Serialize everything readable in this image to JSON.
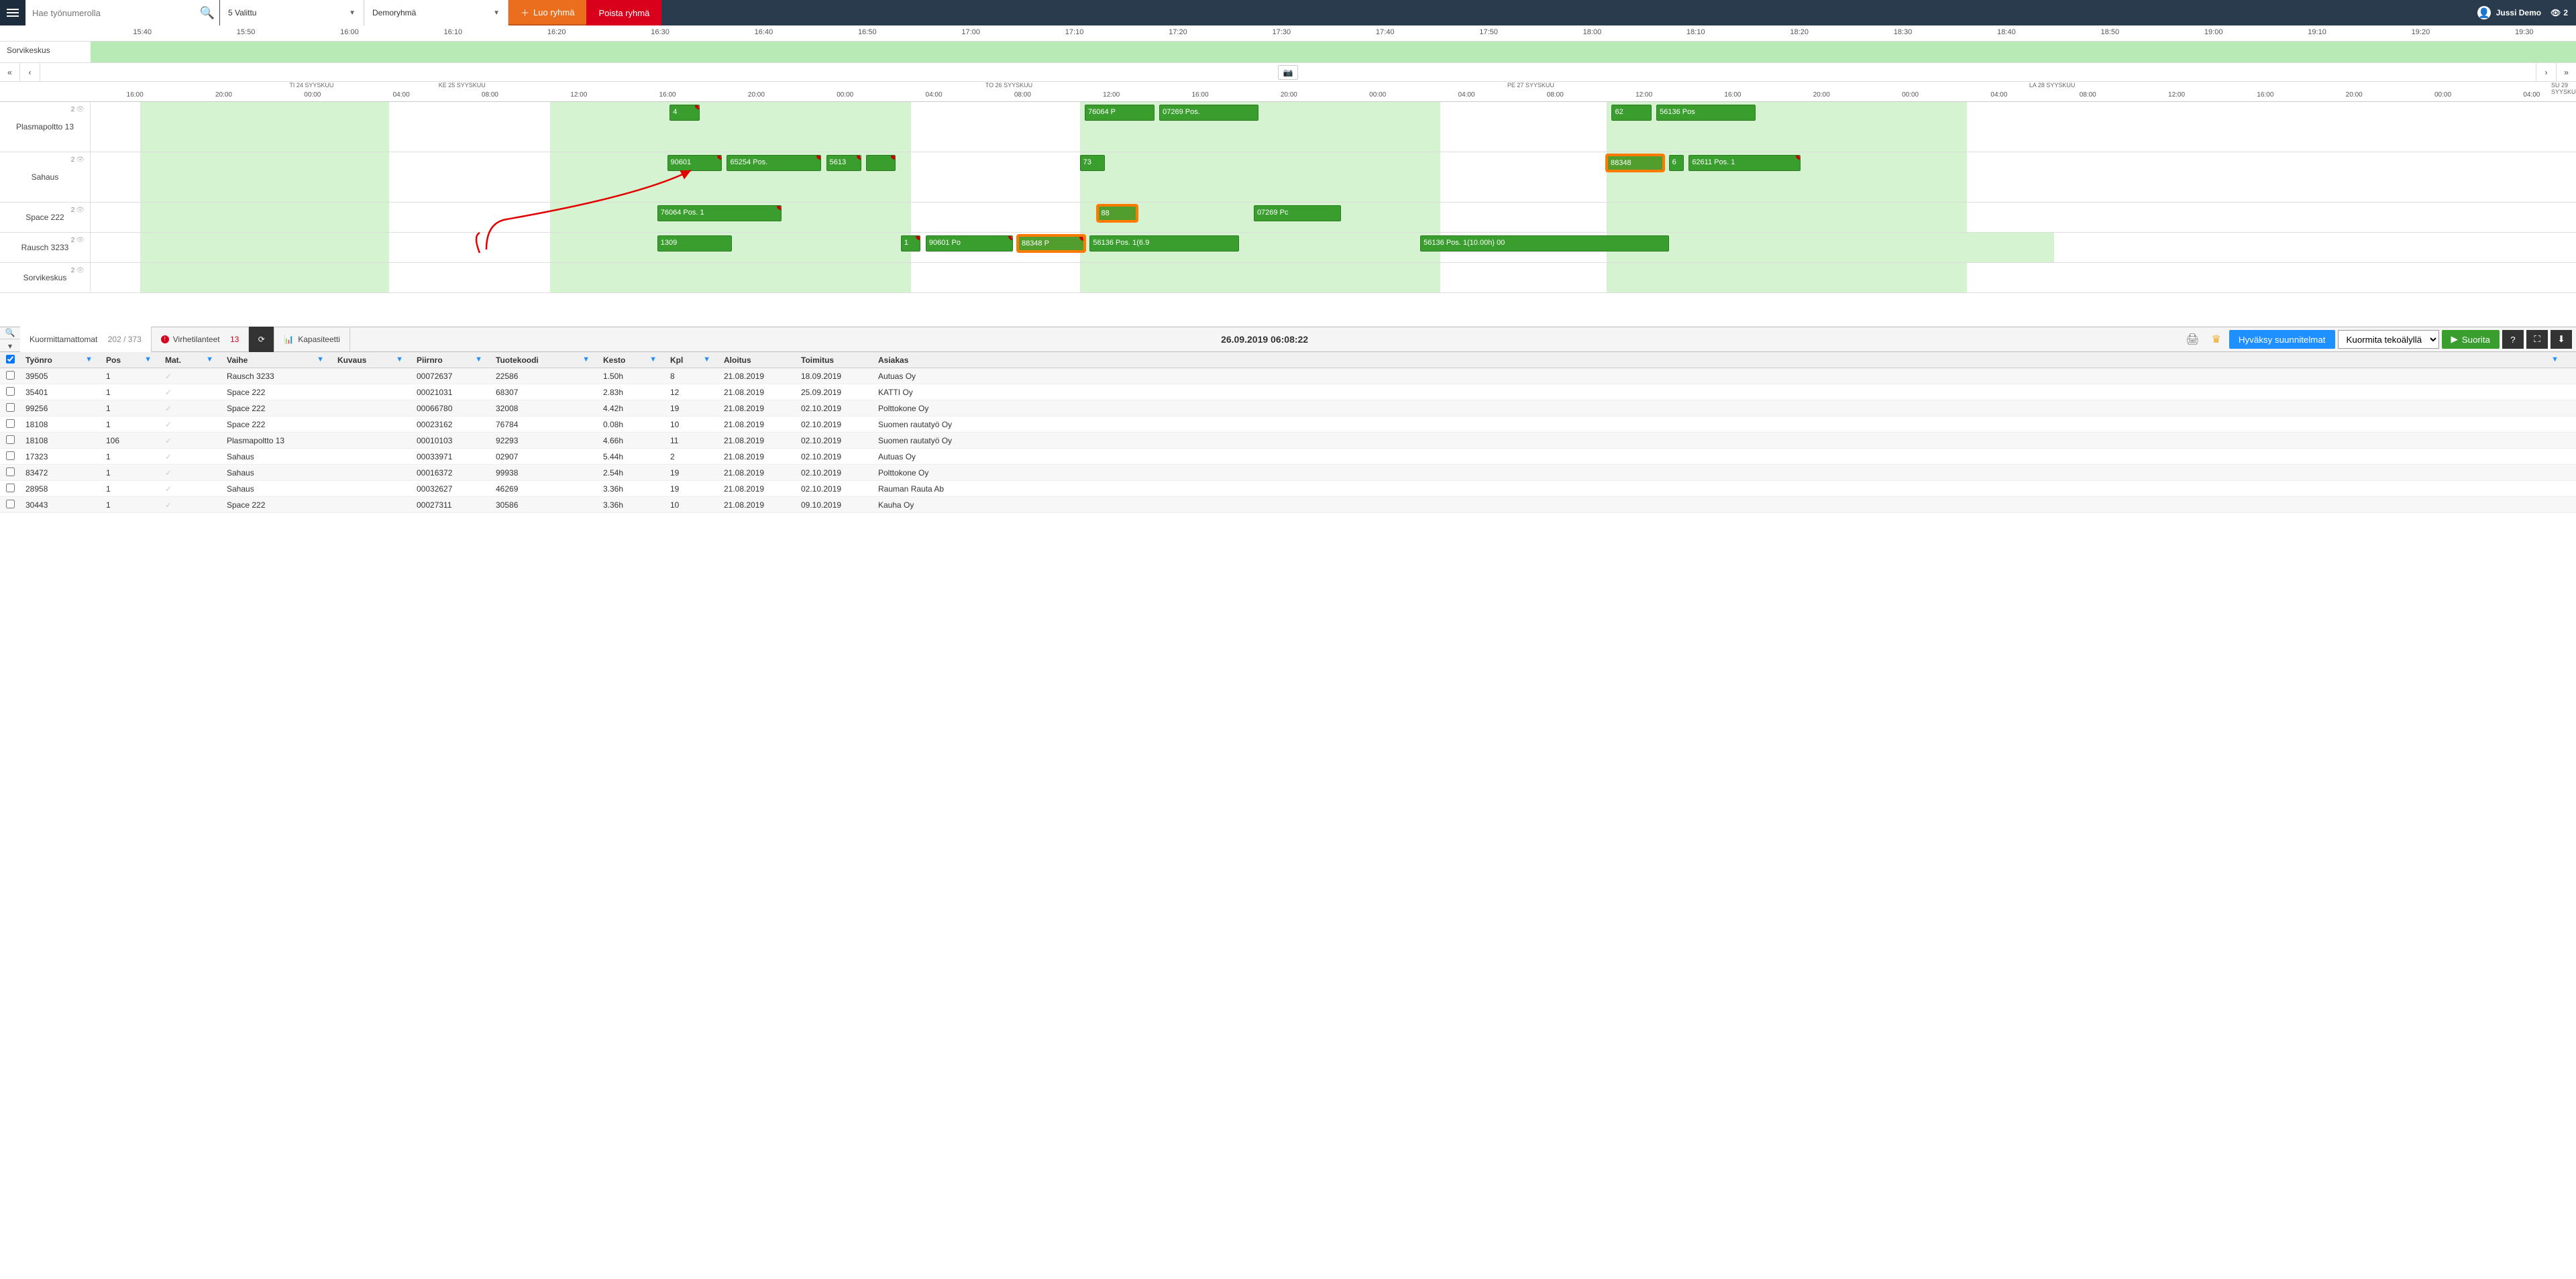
{
  "header": {
    "search_placeholder": "Hae työnumerolla",
    "select1": "5 Valittu",
    "select2": "Demoryhmä",
    "create_group": "Luo ryhmä",
    "delete_group": "Poista ryhmä",
    "user_name": "Jussi Demo",
    "watchers": "2"
  },
  "mini": {
    "label": "Sorvikeskus",
    "ticks": [
      "15:40",
      "15:50",
      "16:00",
      "16:10",
      "16:20",
      "16:30",
      "16:40",
      "16:50",
      "17:00",
      "17:10",
      "17:20",
      "17:30",
      "17:40",
      "17:50",
      "18:00",
      "18:10",
      "18:20",
      "18:30",
      "18:40",
      "18:50",
      "19:00",
      "19:10",
      "19:20",
      "19:30"
    ]
  },
  "gantt": {
    "days": [
      {
        "label": "TI 24 SYYSKUU",
        "left_pct": 8
      },
      {
        "label": "KE 25 SYYSKUU",
        "left_pct": 14
      },
      {
        "label": "TO 26 SYYSKUU",
        "left_pct": 36
      },
      {
        "label": "PE 27 SYYSKUU",
        "left_pct": 57
      },
      {
        "label": "LA 28 SYYSKUU",
        "left_pct": 78
      },
      {
        "label": "SU 29 SYYSKUU",
        "left_pct": 99
      }
    ],
    "hours": [
      "16:00",
      "20:00",
      "00:00",
      "04:00",
      "08:00",
      "12:00",
      "16:00",
      "20:00",
      "00:00",
      "04:00",
      "08:00",
      "12:00",
      "16:00",
      "20:00",
      "00:00",
      "04:00",
      "08:00",
      "12:00",
      "16:00",
      "20:00",
      "00:00",
      "04:00",
      "08:00",
      "12:00",
      "16:00",
      "20:00",
      "00:00",
      "04:00"
    ],
    "now_left_pct": 23.0,
    "rows": [
      {
        "name": "Plasmapoltto 13",
        "count": "2",
        "height": "full",
        "avail": [
          {
            "l": 2,
            "w": 10
          },
          {
            "l": 18.5,
            "w": 14.5
          },
          {
            "l": 39.8,
            "w": 14.5
          },
          {
            "l": 61,
            "w": 14.5
          }
        ],
        "tasks": [
          {
            "l": 23.3,
            "w": 1.2,
            "label": "4",
            "alert": true
          },
          {
            "l": 40,
            "w": 2.8,
            "label": "76064 P"
          },
          {
            "l": 43,
            "w": 4,
            "label": "07269 Pos."
          },
          {
            "l": 61.2,
            "w": 1.6,
            "label": "62"
          },
          {
            "l": 63,
            "w": 4,
            "label": "56136 Pos"
          }
        ]
      },
      {
        "name": "Sahaus",
        "count": "2",
        "height": "full",
        "avail": [
          {
            "l": 2,
            "w": 10
          },
          {
            "l": 18.5,
            "w": 14.5
          },
          {
            "l": 39.8,
            "w": 14.5
          },
          {
            "l": 61,
            "w": 14.5
          }
        ],
        "tasks": [
          {
            "l": 23.2,
            "w": 2.2,
            "label": "90601",
            "alert": true
          },
          {
            "l": 25.6,
            "w": 3.8,
            "label": "65254 Pos.",
            "alert": true
          },
          {
            "l": 29.6,
            "w": 1.4,
            "label": "5613",
            "alert": true
          },
          {
            "l": 31.2,
            "w": 1.2,
            "label": "",
            "alert": true
          },
          {
            "l": 39.8,
            "w": 1,
            "label": "73"
          },
          {
            "l": 61,
            "w": 2.3,
            "label": "88348",
            "sel": true
          },
          {
            "l": 63.5,
            "w": 0.6,
            "label": "6"
          },
          {
            "l": 64.3,
            "w": 4.5,
            "label": "62611 Pos. 1",
            "alert": true
          }
        ]
      },
      {
        "name": "Space 222",
        "count": "2",
        "height": "half",
        "avail": [
          {
            "l": 2,
            "w": 10
          },
          {
            "l": 18.5,
            "w": 14.5
          },
          {
            "l": 39.8,
            "w": 14.5
          },
          {
            "l": 61,
            "w": 14.5
          }
        ],
        "tasks": [
          {
            "l": 22.8,
            "w": 5,
            "label": "76064 Pos. 1",
            "alert": true
          },
          {
            "l": 40.5,
            "w": 1.6,
            "label": "88",
            "sel": true
          },
          {
            "l": 46.8,
            "w": 3.5,
            "label": "07269 Pc"
          }
        ]
      },
      {
        "name": "Rausch 3233",
        "count": "2",
        "height": "half",
        "avail": [
          {
            "l": 2,
            "w": 10
          },
          {
            "l": 18.5,
            "w": 14.5
          },
          {
            "l": 39.8,
            "w": 14.5
          },
          {
            "l": 61,
            "w": 14.5
          },
          {
            "l": 72,
            "w": 7
          }
        ],
        "tasks": [
          {
            "l": 22.8,
            "w": 3,
            "label": "1309"
          },
          {
            "l": 32.6,
            "w": 0.8,
            "label": "1",
            "alert": true
          },
          {
            "l": 33.6,
            "w": 3.5,
            "label": "90601 Po",
            "alert": true
          },
          {
            "l": 37.3,
            "w": 2.7,
            "label": "88348 P",
            "sel": true,
            "alert": true
          },
          {
            "l": 40.2,
            "w": 6,
            "label": "56136 Pos. 1(6.9"
          },
          {
            "l": 53.5,
            "w": 10,
            "label": "56136 Pos. 1(10.00h) 00"
          }
        ]
      },
      {
        "name": "Sorvikeskus",
        "count": "2",
        "height": "half",
        "avail": [
          {
            "l": 2,
            "w": 10
          },
          {
            "l": 18.5,
            "w": 14.5
          },
          {
            "l": 39.8,
            "w": 14.5
          },
          {
            "l": 61,
            "w": 14.5
          }
        ],
        "tasks": []
      }
    ]
  },
  "toolbar": {
    "kuormittamattomat": "Kuormittamattomat",
    "kuorm_count": "202 / 373",
    "virhet": "Virhetilanteet",
    "virhet_count": "13",
    "kapasit": "Kapasiteetti",
    "center_time": "26.09.2019 06:08:22",
    "hyvaksy": "Hyväksy suunnitelmat",
    "ai_select": "Kuormita tekoälyllä",
    "suorita": "Suorita"
  },
  "table": {
    "headers": [
      "Työnro",
      "Pos",
      "Mat.",
      "Vaihe",
      "Kuvaus",
      "Piirnro",
      "Tuotekoodi",
      "Kesto",
      "Kpl",
      "Aloitus",
      "Toimitus",
      "Asiakas"
    ],
    "rows": [
      {
        "tyonro": "39505",
        "pos": "1",
        "vaihe": "Rausch 3233",
        "piirnro": "00072637",
        "tuote": "22586",
        "kesto": "1.50h",
        "kpl": "8",
        "aloitus": "21.08.2019",
        "toimitus": "18.09.2019",
        "asiakas": "Autuas Oy"
      },
      {
        "tyonro": "35401",
        "pos": "1",
        "vaihe": "Space 222",
        "piirnro": "00021031",
        "tuote": "68307",
        "kesto": "2.83h",
        "kpl": "12",
        "aloitus": "21.08.2019",
        "toimitus": "25.09.2019",
        "asiakas": "KATTI Oy"
      },
      {
        "tyonro": "99256",
        "pos": "1",
        "vaihe": "Space 222",
        "piirnro": "00066780",
        "tuote": "32008",
        "kesto": "4.42h",
        "kpl": "19",
        "aloitus": "21.08.2019",
        "toimitus": "02.10.2019",
        "asiakas": "Polttokone Oy"
      },
      {
        "tyonro": "18108",
        "pos": "1",
        "vaihe": "Space 222",
        "piirnro": "00023162",
        "tuote": "76784",
        "kesto": "0.08h",
        "kpl": "10",
        "aloitus": "21.08.2019",
        "toimitus": "02.10.2019",
        "asiakas": "Suomen rautatyö Oy"
      },
      {
        "tyonro": "18108",
        "pos": "106",
        "vaihe": "Plasmapoltto 13",
        "piirnro": "00010103",
        "tuote": "92293",
        "kesto": "4.66h",
        "kpl": "11",
        "aloitus": "21.08.2019",
        "toimitus": "02.10.2019",
        "asiakas": "Suomen rautatyö Oy"
      },
      {
        "tyonro": "17323",
        "pos": "1",
        "vaihe": "Sahaus",
        "piirnro": "00033971",
        "tuote": "02907",
        "kesto": "5.44h",
        "kpl": "2",
        "aloitus": "21.08.2019",
        "toimitus": "02.10.2019",
        "asiakas": "Autuas Oy"
      },
      {
        "tyonro": "83472",
        "pos": "1",
        "vaihe": "Sahaus",
        "piirnro": "00016372",
        "tuote": "99938",
        "kesto": "2.54h",
        "kpl": "19",
        "aloitus": "21.08.2019",
        "toimitus": "02.10.2019",
        "asiakas": "Polttokone Oy"
      },
      {
        "tyonro": "28958",
        "pos": "1",
        "vaihe": "Sahaus",
        "piirnro": "00032627",
        "tuote": "46269",
        "kesto": "3.36h",
        "kpl": "19",
        "aloitus": "21.08.2019",
        "toimitus": "02.10.2019",
        "asiakas": "Rauman Rauta Ab"
      },
      {
        "tyonro": "30443",
        "pos": "1",
        "vaihe": "Space 222",
        "piirnro": "00027311",
        "tuote": "30586",
        "kesto": "3.36h",
        "kpl": "10",
        "aloitus": "21.08.2019",
        "toimitus": "09.10.2019",
        "asiakas": "Kauha Oy"
      }
    ]
  }
}
